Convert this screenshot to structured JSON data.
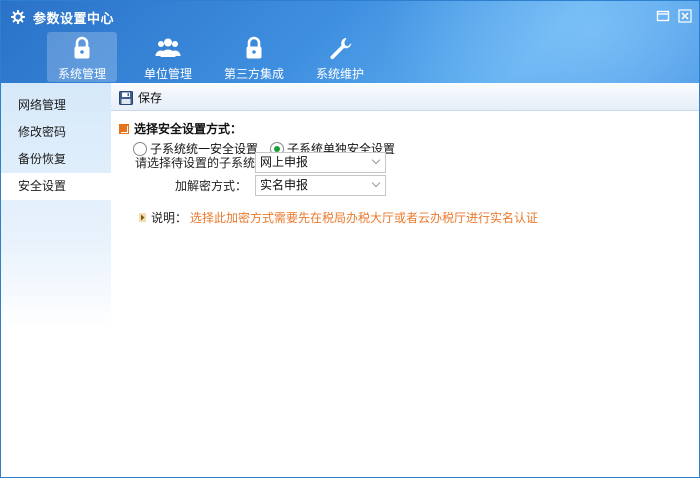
{
  "window": {
    "title": "参数设置中心",
    "icons": {
      "app": "gear-icon",
      "restore": "restore-window-icon",
      "close": "close-icon"
    }
  },
  "nav": {
    "tabs": [
      {
        "label": "系统管理",
        "icon": "lock-icon",
        "active": true
      },
      {
        "label": "单位管理",
        "icon": "users-icon",
        "active": false
      },
      {
        "label": "第三方集成",
        "icon": "lock-icon",
        "active": false
      },
      {
        "label": "系统维护",
        "icon": "wrench-icon",
        "active": false
      }
    ]
  },
  "sidebar": {
    "items": [
      {
        "label": "网络管理",
        "active": false
      },
      {
        "label": "修改密码",
        "active": false
      },
      {
        "label": "备份恢复",
        "active": false
      },
      {
        "label": "安全设置",
        "active": true
      }
    ]
  },
  "toolbar": {
    "save_label": "保存",
    "save_icon": "save-disk-icon"
  },
  "main": {
    "section_title": "选择安全设置方式：",
    "radios": [
      {
        "label": "子系统统一安全设置",
        "checked": false
      },
      {
        "label": "子系统单独安全设置",
        "checked": true
      }
    ],
    "subsystem_label": "请选择待设置的子系统：",
    "subsystem_value": "网上申报",
    "encryption_label": "加解密方式：",
    "encryption_value": "实名申报",
    "note_label": "说明：",
    "note_text": "选择此加密方式需要先在税局办税大厅或者云办税厅进行实名认证"
  },
  "colors": {
    "header_blue": "#3f8fe0",
    "note_orange": "#ea7a2c",
    "radio_green": "#1a9f3a"
  }
}
